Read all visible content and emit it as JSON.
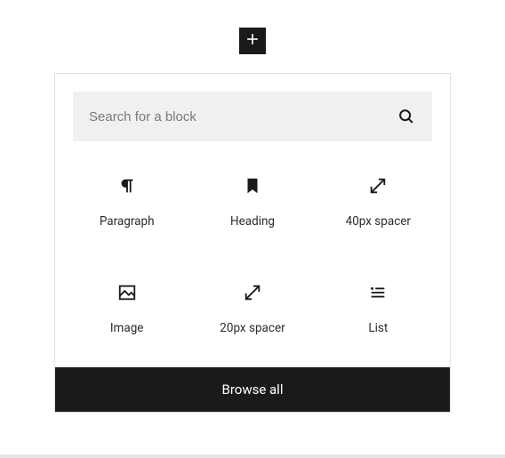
{
  "search": {
    "placeholder": "Search for a block"
  },
  "blocks": [
    {
      "label": "Paragraph"
    },
    {
      "label": "Heading"
    },
    {
      "label": "40px spacer"
    },
    {
      "label": "Image"
    },
    {
      "label": "20px spacer"
    },
    {
      "label": "List"
    }
  ],
  "browse_all_label": "Browse all"
}
